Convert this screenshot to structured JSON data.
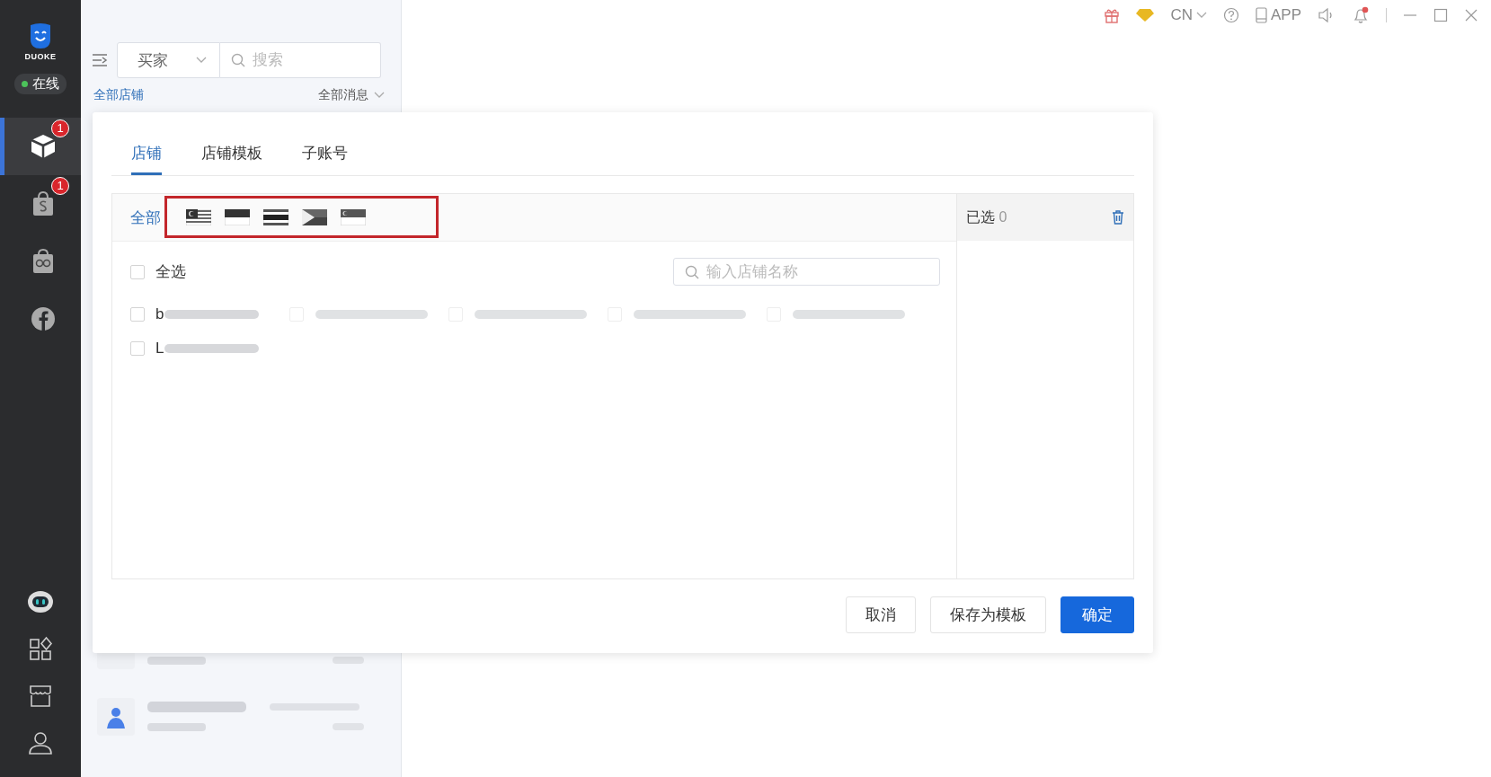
{
  "sidebar": {
    "logo_text": "DUOKE",
    "status": "在线",
    "online": true,
    "items": [
      {
        "kind": "box",
        "selected": true,
        "badge": "1"
      },
      {
        "kind": "bag",
        "selected": false,
        "badge": "1"
      },
      {
        "kind": "owl",
        "selected": false
      },
      {
        "kind": "facebook",
        "selected": false
      }
    ],
    "bottom_items": [
      {
        "kind": "robot"
      },
      {
        "kind": "apps"
      },
      {
        "kind": "store"
      },
      {
        "kind": "user"
      }
    ]
  },
  "topbar": {
    "language": "CN",
    "app_label": "APP",
    "notification_dot": true
  },
  "chat_panel": {
    "role_select": "买家",
    "search": {
      "placeholder": "搜索"
    },
    "store_filter": "全部店铺",
    "message_filter": "全部消息",
    "chats": [
      {
        "kind": "blurred",
        "avatar": false
      },
      {
        "kind": "blurred",
        "avatar": true
      }
    ]
  },
  "dialog": {
    "tabs": [
      {
        "label": "店铺",
        "selected": true
      },
      {
        "label": "店铺模板",
        "selected": false
      },
      {
        "label": "子账号",
        "selected": false
      }
    ],
    "filter": {
      "all_label": "全部",
      "highlighted": true,
      "flags": [
        {
          "kind": "malaysia"
        },
        {
          "kind": "indonesia"
        },
        {
          "kind": "thailand"
        },
        {
          "kind": "philippines"
        },
        {
          "kind": "singapore"
        }
      ]
    },
    "select_all": {
      "label": "全选",
      "checked": false
    },
    "search": {
      "placeholder": "输入店铺名称"
    },
    "stores": [
      {
        "kind": "named",
        "name": "b",
        "checked": false
      },
      {
        "kind": "blurred",
        "checked": false
      },
      {
        "kind": "blurred",
        "checked": false
      },
      {
        "kind": "blurred",
        "checked": false
      },
      {
        "kind": "blurred",
        "checked": false
      },
      {
        "kind": "named",
        "name": "L",
        "checked": false
      }
    ],
    "selected_panel": {
      "label": "已选",
      "count": "0"
    },
    "buttons": [
      {
        "label": "取消",
        "kind": "default"
      },
      {
        "label": "保存为模板",
        "kind": "default"
      },
      {
        "label": "确定",
        "kind": "primary"
      }
    ]
  }
}
